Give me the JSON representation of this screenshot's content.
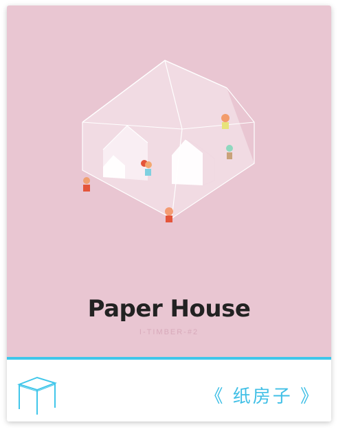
{
  "cover": {
    "title": "Paper House",
    "subtitle": "I-TIMBER-#2"
  },
  "footer": {
    "label": "《 纸房子 》",
    "icon": "table-icon"
  },
  "colors": {
    "background": "#e9c6d2",
    "accent": "#3fc6ea",
    "title": "#222222"
  }
}
